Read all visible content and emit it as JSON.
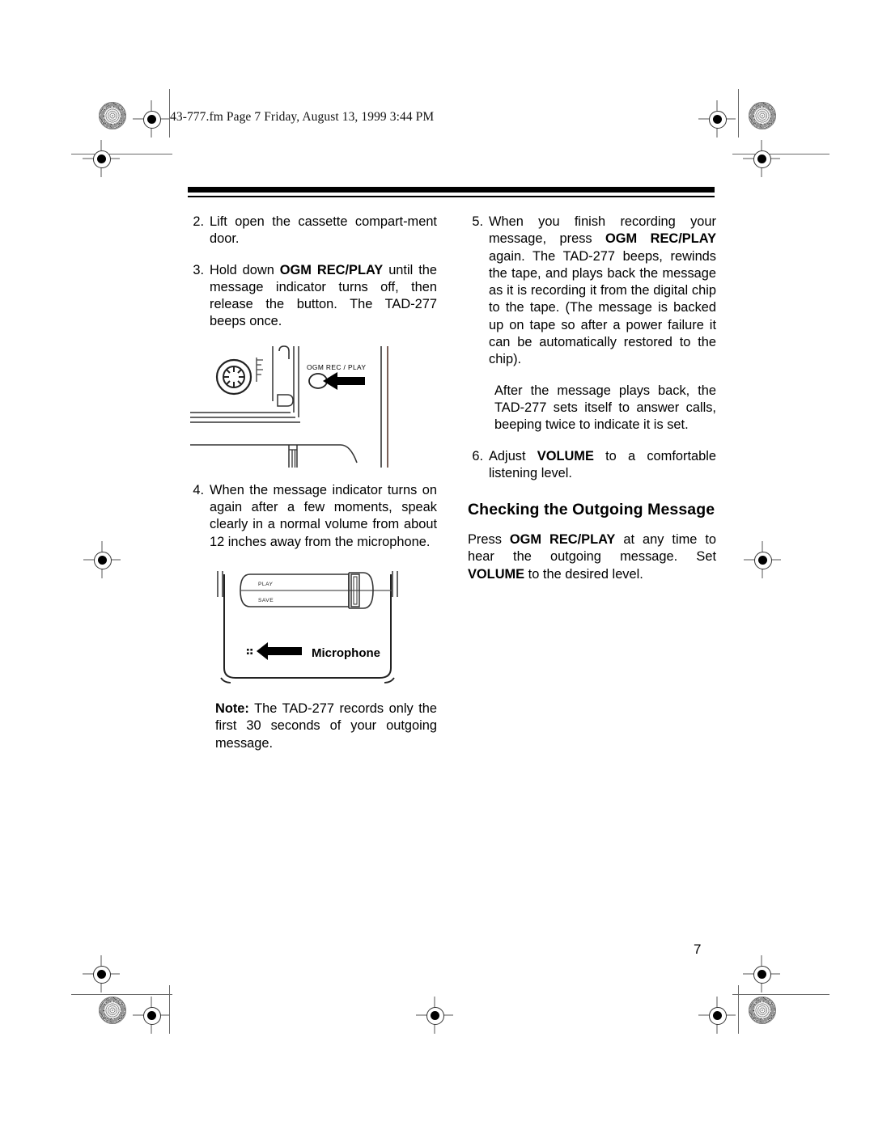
{
  "page": {
    "filestamp": "43-777.fm  Page 7  Friday, August 13, 1999  3:44 PM",
    "page_number": "7"
  },
  "left_column": {
    "steps": [
      {
        "number": "2.",
        "segments": [
          {
            "text": "Lift open the cassette compart-ment door.",
            "bold": false
          }
        ]
      },
      {
        "number": "3.",
        "segments": [
          {
            "text": "Hold down ",
            "bold": false
          },
          {
            "text": "OGM REC/PLAY",
            "bold": true
          },
          {
            "text": " until the message indicator turns off, then release the button. The TAD-277 beeps once.",
            "bold": false
          }
        ]
      },
      {
        "number": "4.",
        "segments": [
          {
            "text": "When the message indicator turns on again after a few moments, speak clearly in a normal volume from about 12 inches away from the microphone.",
            "bold": false
          }
        ]
      }
    ],
    "note": {
      "label": "Note:",
      "text": " The TAD-277 records only the first 30 seconds of your outgoing message."
    }
  },
  "right_column": {
    "steps": [
      {
        "number": "5.",
        "segments": [
          {
            "text": "When you finish recording your message, press ",
            "bold": false
          },
          {
            "text": "OGM REC/PLAY",
            "bold": true
          },
          {
            "text": " again. The TAD-277 beeps, rewinds the tape, and plays back the message as it is recording it from the digital chip to the tape. (The message is backed up on tape so after a power failure it can be automatically restored to the chip).",
            "bold": false
          }
        ]
      }
    ],
    "continuation": "After the message plays back, the TAD-277 sets itself to answer calls, beeping twice to indicate it is set.",
    "step6": {
      "number": "6.",
      "segments": [
        {
          "text": "Adjust ",
          "bold": false
        },
        {
          "text": "VOLUME",
          "bold": true
        },
        {
          "text": " to a comfortable listening level.",
          "bold": false
        }
      ]
    },
    "heading": "Checking the Outgoing Message",
    "closing_paragraph": {
      "segments": [
        {
          "text": "Press ",
          "bold": false
        },
        {
          "text": "OGM REC/PLAY",
          "bold": true
        },
        {
          "text": " at any time to hear the outgoing message. Set ",
          "bold": false
        },
        {
          "text": "VOLUME",
          "bold": true
        },
        {
          "text": " to the desired level.",
          "bold": false
        }
      ]
    }
  },
  "figures": {
    "cassette": {
      "button_label": "OGM REC / PLAY"
    },
    "handset": {
      "play_label": "PLAY",
      "save_label": "SAVE",
      "microphone_label": "Microphone"
    }
  },
  "colors": {
    "ink": "#000000",
    "line_gray": "#555555",
    "paper": "#ffffff"
  }
}
